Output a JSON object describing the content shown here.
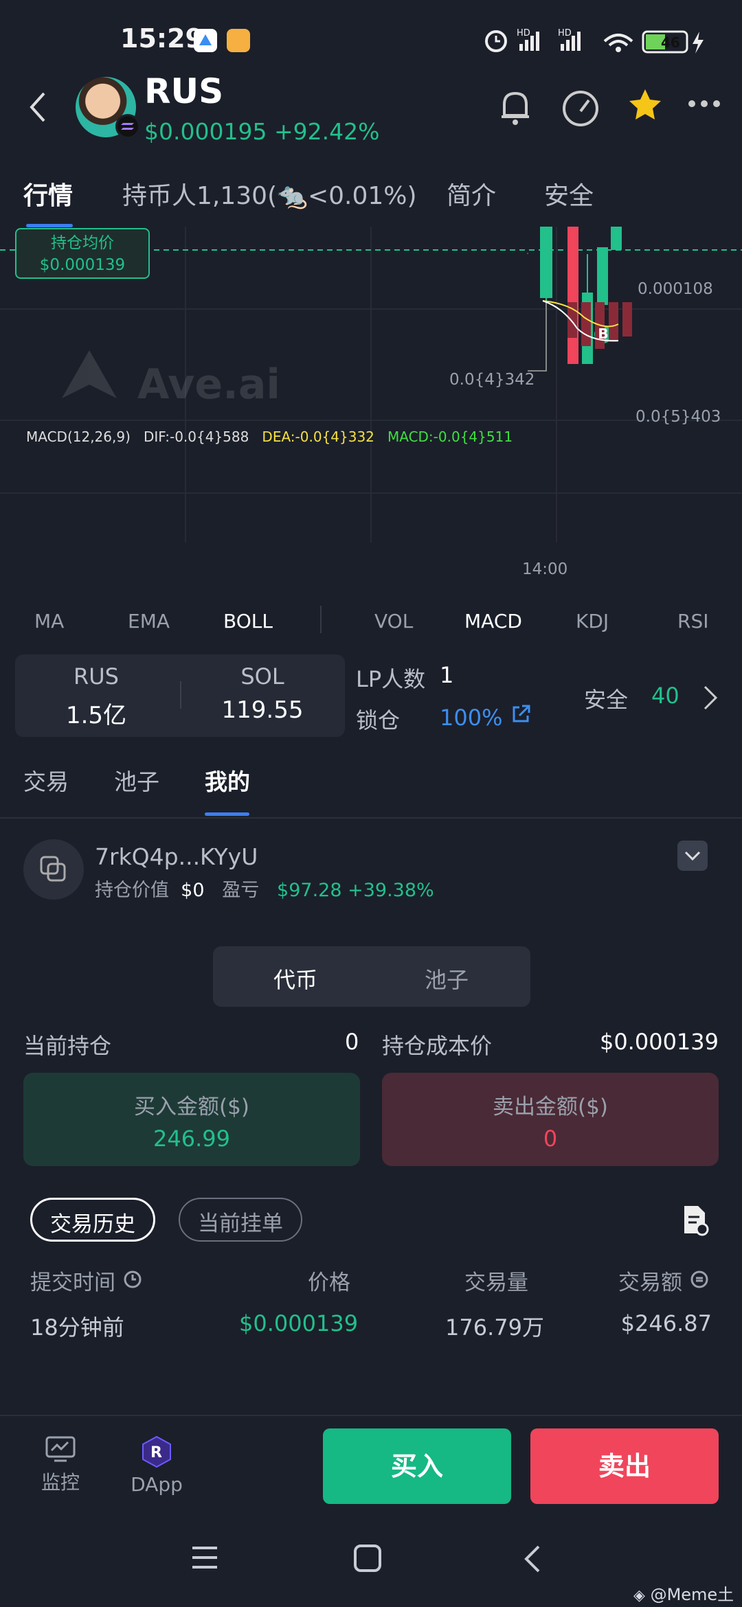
{
  "status": {
    "time": "15:29",
    "battery": "46"
  },
  "header": {
    "title": "RUS",
    "price": "$0.000195",
    "change": "+92.42%"
  },
  "tabs": [
    "行情",
    "持币人1,130",
    "<0.01%)",
    "简介",
    "安全"
  ],
  "chart": {
    "avg_label": "持仓均价",
    "avg_value": "$0.000139",
    "y_label_1": "0.000108",
    "low_label": "0.0{4}342",
    "y_label_2": "0.0{5}403",
    "macd_title": "MACD(12,26,9)",
    "dif": "DIF:-0.0{4}588",
    "dea": "DEA:-0.0{4}332",
    "macd": "MACD:-0.0{4}511",
    "x_label": "14:00",
    "buy_marker": "B",
    "watermark": "Ave.ai"
  },
  "indicators": [
    "MA",
    "EMA",
    "BOLL",
    "VOL",
    "MACD",
    "KDJ",
    "RSI"
  ],
  "pool": {
    "sym1": "RUS",
    "val1": "1.5亿",
    "sym2": "SOL",
    "val2": "119.55",
    "lp_label": "LP人数",
    "lp_value": "1",
    "lock_label": "锁仓",
    "lock_value": "100%",
    "safety_label": "安全",
    "safety_value": "40"
  },
  "subtabs": [
    "交易",
    "池子",
    "我的"
  ],
  "wallet": {
    "address": "7rkQ4p...KYyU",
    "value_label": "持仓价值",
    "value": "$0",
    "pnl_label": "盈亏",
    "pnl": "$97.28 +39.38%"
  },
  "segment": [
    "代币",
    "池子"
  ],
  "position": {
    "holding_label": "当前持仓",
    "holding_value": "0",
    "cost_label": "持仓成本价",
    "cost_value": "$0.000139"
  },
  "amounts": {
    "buy_label": "买入金额($)",
    "buy_value": "246.99",
    "sell_label": "卖出金额($)",
    "sell_value": "0"
  },
  "history_tabs": [
    "交易历史",
    "当前挂单"
  ],
  "table": {
    "headers": [
      "提交时间",
      "价格",
      "交易量",
      "交易额"
    ],
    "rows": [
      [
        "18分钟前",
        "$0.000139",
        "176.79万",
        "$246.87"
      ]
    ]
  },
  "bottom": {
    "monitor": "监控",
    "dapp": "DApp",
    "buy": "买入",
    "sell": "卖出"
  },
  "footer_watermark": "@Meme土"
}
